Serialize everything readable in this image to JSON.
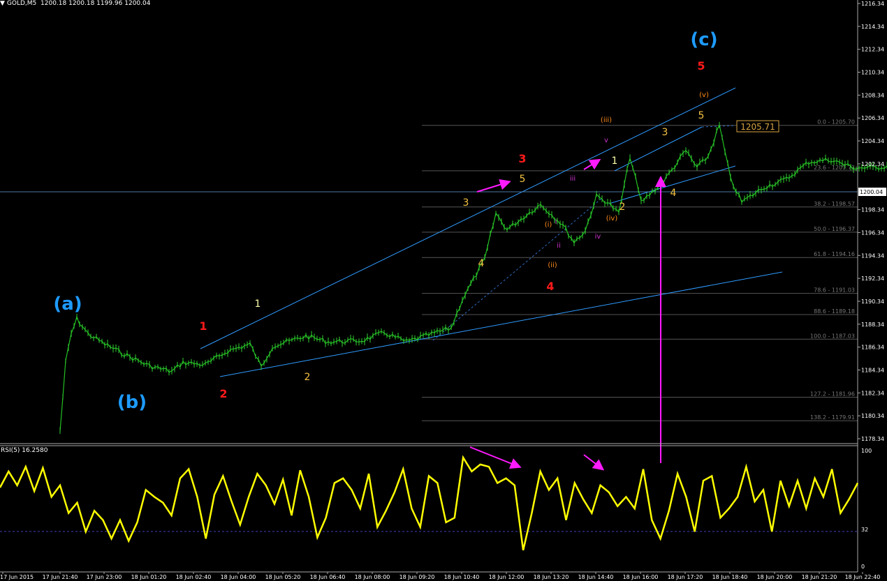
{
  "header": {
    "symbol": "GOLD,M5",
    "ohlc": "1200.18 1200.18 1199.96 1200.04"
  },
  "rsi_header": "RSI(5) 16.2580",
  "price_axis": {
    "labels": [
      "1216.34",
      "1214.34",
      "1212.34",
      "1210.34",
      "1208.34",
      "1206.34",
      "1204.34",
      "1202.34",
      "1198.34",
      "1196.34",
      "1194.34",
      "1192.34",
      "1190.34",
      "1188.34",
      "1186.34",
      "1184.34",
      "1182.34",
      "1180.34",
      "1178.34"
    ],
    "current_price": "1200.04"
  },
  "rsi_axis": {
    "labels": [
      "100",
      "32",
      "0"
    ]
  },
  "time_axis": {
    "labels": [
      "17 Jun 2015",
      "17 Jun 21:40",
      "17 Jun 23:00",
      "18 Jun 01:20",
      "18 Jun 02:40",
      "18 Jun 04:00",
      "18 Jun 05:20",
      "18 Jun 06:40",
      "18 Jun 08:00",
      "18 Jun 09:20",
      "18 Jun 10:40",
      "18 Jun 12:00",
      "18 Jun 13:20",
      "18 Jun 14:40",
      "18 Jun 16:00",
      "18 Jun 17:20",
      "18 Jun 18:40",
      "18 Jun 20:00",
      "18 Jun 21:20",
      "18 Jun 22:40"
    ]
  },
  "fib_levels": [
    {
      "label": "0.0 - 1205.70",
      "price": 1205.7
    },
    {
      "label": "23.6 - 1201.73",
      "price": 1201.73
    },
    {
      "label": "38.2 - 1198.57",
      "price": 1198.57
    },
    {
      "label": "50.0 - 1196.37",
      "price": 1196.37
    },
    {
      "label": "61.8 - 1194.16",
      "price": 1194.16
    },
    {
      "label": "78.6 - 1191.03",
      "price": 1191.03
    },
    {
      "label": "88.6 - 1189.18",
      "price": 1189.18
    },
    {
      "label": "100.0 - 1187.03",
      "price": 1187.03
    },
    {
      "label": "127.2 - 1181.96",
      "price": 1181.96
    },
    {
      "label": "138.2 - 1179.91",
      "price": 1179.91
    }
  ],
  "price_callout": "1205.71",
  "wave_labels": [
    {
      "text": "(a)",
      "color": "#1e9bff",
      "size": "large"
    },
    {
      "text": "(b)",
      "color": "#1e9bff",
      "size": "large"
    },
    {
      "text": "(c)",
      "color": "#1e9bff",
      "size": "large"
    },
    {
      "text": "1",
      "color": "#ff1a1a",
      "size": "medium"
    },
    {
      "text": "2",
      "color": "#ff1a1a",
      "size": "medium"
    },
    {
      "text": "3",
      "color": "#ff1a1a",
      "size": "medium"
    },
    {
      "text": "4",
      "color": "#ff1a1a",
      "size": "medium"
    },
    {
      "text": "5",
      "color": "#ff1a1a",
      "size": "medium"
    },
    {
      "text": "1",
      "color": "#ffffaa",
      "size": "small"
    },
    {
      "text": "2",
      "color": "#f5c242",
      "size": "small"
    },
    {
      "text": "3",
      "color": "#f5c242",
      "size": "small"
    },
    {
      "text": "4",
      "color": "#f5c242",
      "size": "small"
    },
    {
      "text": "5",
      "color": "#f5c242",
      "size": "small"
    },
    {
      "text": "1",
      "color": "#ffffaa",
      "size": "small"
    },
    {
      "text": "2",
      "color": "#f5c242",
      "size": "small"
    },
    {
      "text": "3",
      "color": "#f5c242",
      "size": "small"
    },
    {
      "text": "4",
      "color": "#f5c242",
      "size": "small"
    },
    {
      "text": "5",
      "color": "#f5c242",
      "size": "small"
    },
    {
      "text": "(i)",
      "color": "#ff8c1a",
      "size": "tiny"
    },
    {
      "text": "(ii)",
      "color": "#ff8c1a",
      "size": "tiny"
    },
    {
      "text": "(iii)",
      "color": "#ff8c1a",
      "size": "tiny"
    },
    {
      "text": "(iv)",
      "color": "#ff8c1a",
      "size": "tiny"
    },
    {
      "text": "(v)",
      "color": "#ff8c1a",
      "size": "tiny"
    },
    {
      "text": "i",
      "color": "#cc33cc",
      "size": "tiny"
    },
    {
      "text": "ii",
      "color": "#cc33cc",
      "size": "tiny"
    },
    {
      "text": "iii",
      "color": "#cc33cc",
      "size": "tiny"
    },
    {
      "text": "iv",
      "color": "#cc33cc",
      "size": "tiny"
    },
    {
      "text": "v",
      "color": "#cc33cc",
      "size": "tiny"
    }
  ],
  "chart_data": {
    "type": "line",
    "symbol": "GOLD",
    "timeframe": "M5",
    "price_range": [
      1177.5,
      1217.2
    ],
    "price_series": [
      [
        "17 Jun 21:40",
        1179.0
      ],
      [
        "17 Jun 21:50",
        1185.0
      ],
      [
        "17 Jun 22:00",
        1187.5
      ],
      [
        "17 Jun 22:10",
        1188.8
      ],
      [
        "17 Jun 22:30",
        1187.5
      ],
      [
        "17 Jun 23:00",
        1186.6
      ],
      [
        "17 Jun 23:40",
        1185.6
      ],
      [
        "18 Jun 00:20",
        1184.7
      ],
      [
        "18 Jun 01:00",
        1184.2
      ],
      [
        "18 Jun 01:20",
        1185.0
      ],
      [
        "18 Jun 02:00",
        1184.8
      ],
      [
        "18 Jun 02:40",
        1186.0
      ],
      [
        "18 Jun 03:20",
        1186.6
      ],
      [
        "18 Jun 03:40",
        1184.6
      ],
      [
        "18 Jun 04:00",
        1186.4
      ],
      [
        "18 Jun 05:00",
        1187.3
      ],
      [
        "18 Jun 05:40",
        1186.8
      ],
      [
        "18 Jun 06:40",
        1186.9
      ],
      [
        "18 Jun 07:20",
        1187.6
      ],
      [
        "18 Jun 08:00",
        1186.8
      ],
      [
        "18 Jun 09:20",
        1188.0
      ],
      [
        "18 Jun 09:40",
        1190.5
      ],
      [
        "18 Jun 10:20",
        1194.0
      ],
      [
        "18 Jun 10:40",
        1198.0
      ],
      [
        "18 Jun 11:00",
        1196.6
      ],
      [
        "18 Jun 12:00",
        1198.8
      ],
      [
        "18 Jun 12:40",
        1197.0
      ],
      [
        "18 Jun 13:00",
        1195.5
      ],
      [
        "18 Jun 13:20",
        1196.5
      ],
      [
        "18 Jun 13:40",
        1199.5
      ],
      [
        "18 Jun 14:00",
        1199.0
      ],
      [
        "18 Jun 14:20",
        1198.0
      ],
      [
        "18 Jun 14:40",
        1203.0
      ],
      [
        "18 Jun 15:00",
        1199.0
      ],
      [
        "18 Jun 15:40",
        1200.8
      ],
      [
        "18 Jun 16:20",
        1203.5
      ],
      [
        "18 Jun 16:40",
        1202.0
      ],
      [
        "18 Jun 17:00",
        1203.0
      ],
      [
        "18 Jun 17:20",
        1205.7
      ],
      [
        "18 Jun 17:40",
        1201.0
      ],
      [
        "18 Jun 18:00",
        1199.0
      ],
      [
        "18 Jun 18:40",
        1200.3
      ],
      [
        "18 Jun 19:20",
        1201.0
      ],
      [
        "18 Jun 20:00",
        1202.5
      ],
      [
        "18 Jun 20:40",
        1202.7
      ],
      [
        "18 Jun 21:20",
        1202.0
      ],
      [
        "18 Jun 22:00",
        1202.0
      ],
      [
        "18 Jun 22:40",
        1202.3
      ]
    ],
    "current_price": 1200.04,
    "rsi": {
      "name": "RSI(5)",
      "last_value": 16.258,
      "range": [
        0,
        100
      ],
      "level_line": 32,
      "values": [
        68,
        82,
        70,
        86,
        65,
        85,
        60,
        70,
        46,
        55,
        30,
        48,
        40,
        24,
        40,
        22,
        38,
        66,
        60,
        55,
        44,
        76,
        84,
        60,
        24,
        62,
        78,
        56,
        36,
        60,
        80,
        70,
        54,
        75,
        44,
        83,
        60,
        25,
        42,
        72,
        76,
        66,
        50,
        80,
        34,
        48,
        64,
        84,
        50,
        34,
        78,
        72,
        38,
        42,
        94,
        82,
        88,
        86,
        72,
        76,
        70,
        14,
        46,
        82,
        66,
        76,
        40,
        72,
        58,
        46,
        70,
        64,
        52,
        60,
        50,
        84,
        40,
        24,
        48,
        80,
        60,
        30,
        74,
        78,
        42,
        50,
        60,
        86,
        56,
        66,
        30,
        74,
        52,
        74,
        50,
        76,
        60,
        84,
        46,
        58,
        72
      ]
    },
    "grid": false,
    "legend": "none"
  }
}
